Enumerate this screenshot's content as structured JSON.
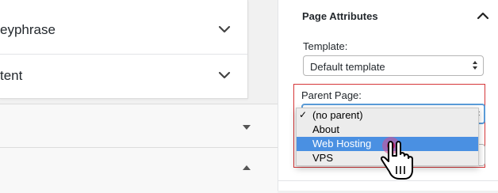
{
  "main": {
    "collapsible_rows": [
      {
        "label": "eyphrase"
      },
      {
        "label": "tent"
      }
    ]
  },
  "sidebar": {
    "panel_title": "Page Attributes",
    "template": {
      "label": "Template:",
      "value": "Default template"
    },
    "parent_page": {
      "label": "Parent Page:",
      "selected": "(no parent)",
      "options": [
        "(no parent)",
        "About",
        "Web Hosting",
        "VPS"
      ],
      "highlighted": "Web Hosting",
      "check": "✓"
    }
  },
  "colors": {
    "accent": "#4a90e2",
    "focus_border": "#5b9dd9",
    "highlight_box": "#d63638"
  }
}
